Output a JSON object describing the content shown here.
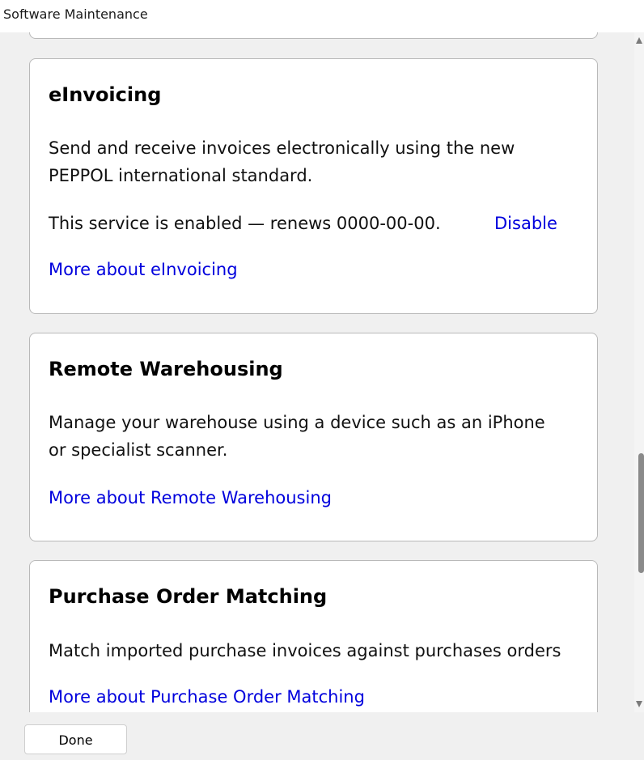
{
  "window": {
    "title": "Software Maintenance"
  },
  "cards": {
    "einvoicing": {
      "title": "eInvoicing",
      "description_line1": "Send and receive invoices electronically using the new",
      "description_line2": "PEPPOL international standard.",
      "status": "This service is enabled — renews 0000-00-00.",
      "disable_label": "Disable",
      "more_link": "More about eInvoicing"
    },
    "remote_warehousing": {
      "title": "Remote Warehousing",
      "description_line1": "Manage your warehouse using a device such as an iPhone",
      "description_line2": "or specialist scanner.",
      "more_link": "More about Remote Warehousing"
    },
    "po_matching": {
      "title": "Purchase Order Matching",
      "description_line1": "Match imported purchase invoices against purchases orders",
      "more_link": "More about Purchase Order Matching"
    }
  },
  "footer": {
    "done_label": "Done"
  },
  "colors": {
    "link": "#0000dd",
    "card_border": "#b9b9b9",
    "background": "#f0f0f0"
  }
}
